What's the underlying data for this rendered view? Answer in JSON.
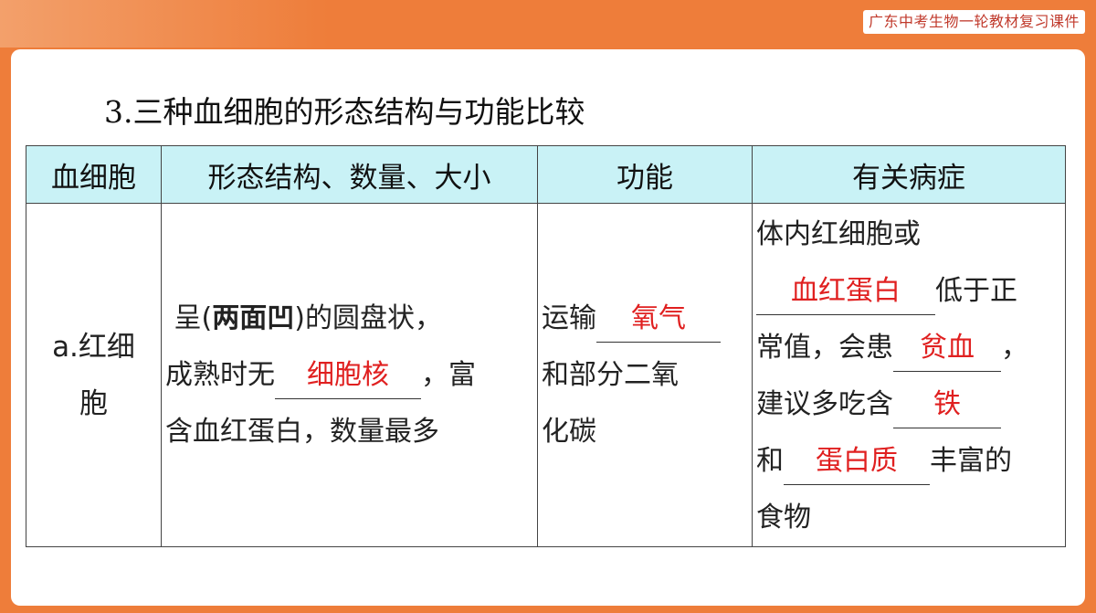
{
  "header": {
    "series_title": "广东中考生物一轮教材复习课件"
  },
  "section": {
    "heading": "3.三种血细胞的形态结构与功能比较"
  },
  "table": {
    "headers": [
      "血细胞",
      "形态结构、数量、大小",
      "功能",
      "有关病症"
    ],
    "row": {
      "name_1": "a.红细",
      "name_2": "胞",
      "morph": {
        "line1_a": "呈(",
        "line1_bold": "两面凹",
        "line1_b": ")的圆盘状，",
        "line2_a": "成熟时无",
        "blank_nucleus": "细胞核",
        "line2_b": "，富",
        "line3": "含血红蛋白，数量最多"
      },
      "function": {
        "line1_a": "运输",
        "blank_oxygen": "氧气",
        "line2": "和部分二氧",
        "line3": "化碳"
      },
      "disease": {
        "line1": "体内红细胞或",
        "blank_hemoglobin": "血红蛋白",
        "line2_b": "低于正",
        "line3_a": "常值，会患",
        "blank_anemia": "贫血",
        "line3_b": "，",
        "line4_a": "建议多吃含",
        "blank_iron": "铁",
        "line5_a": "和",
        "blank_protein": "蛋白质",
        "line5_b": "丰富的",
        "line6": "食物"
      }
    }
  },
  "colors": {
    "frame": "#ee7d3a",
    "header_cell": "#c9f2f6",
    "answer": "#e02020"
  }
}
